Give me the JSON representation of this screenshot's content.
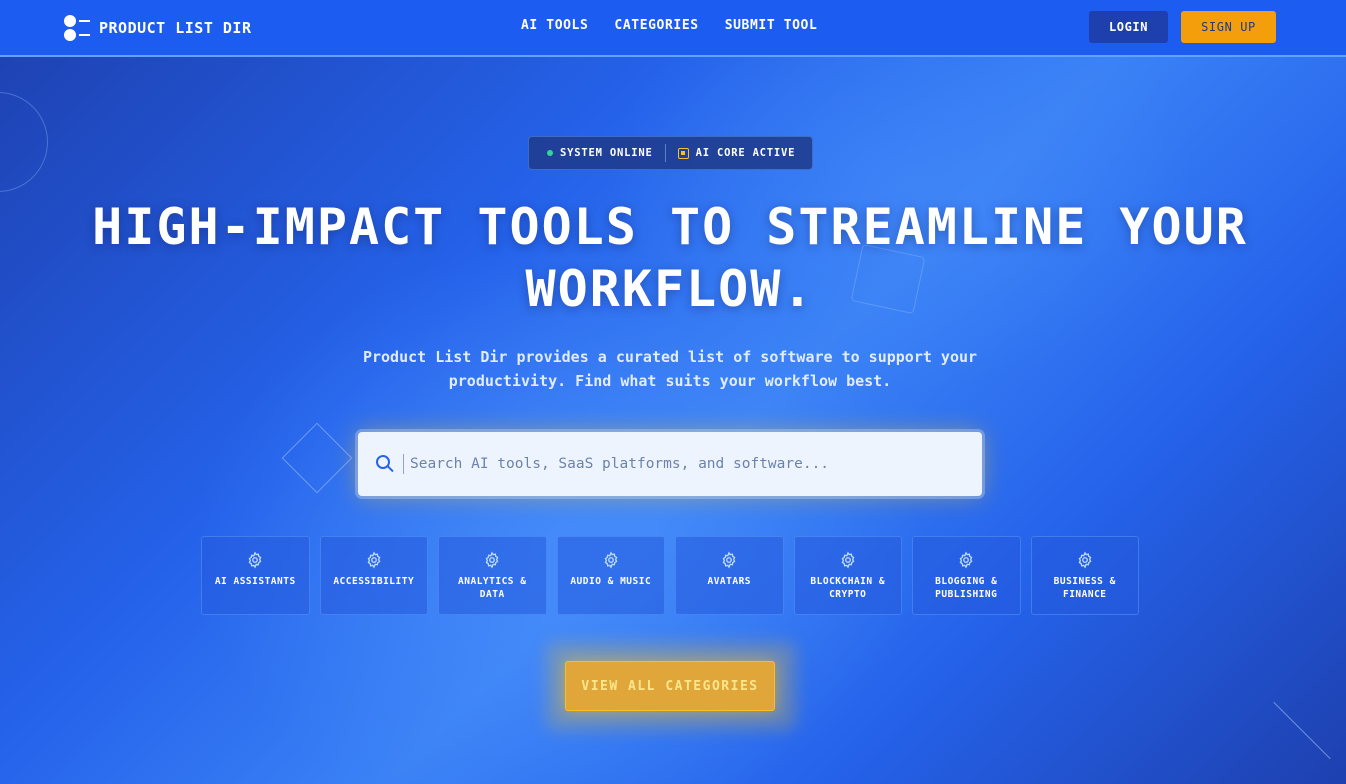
{
  "nav": {
    "brand": "PRODUCT LIST DIR",
    "links": [
      "AI TOOLS",
      "CATEGORIES",
      "SUBMIT TOOL"
    ],
    "login_label": "LOGIN",
    "signup_label": "SIGN UP"
  },
  "status": {
    "system": "SYSTEM ONLINE",
    "core": "AI CORE ACTIVE"
  },
  "hero": {
    "headline_line1": "HIGH-IMPACT TOOLS TO STREAMLINE YOUR",
    "headline_line2": "WORKFLOW.",
    "subtitle_line1": "Product List Dir provides a curated list of software to support your",
    "subtitle_line2": "productivity. Find what suits your workflow best."
  },
  "search": {
    "placeholder": "Search AI tools, SaaS platforms, and software...",
    "value": ""
  },
  "categories": [
    {
      "line1": "AI ASSISTANTS",
      "line2": "",
      "icon": "gear-icon"
    },
    {
      "line1": "ACCESSIBILITY",
      "line2": "",
      "icon": "gear-icon"
    },
    {
      "line1": "ANALYTICS &",
      "line2": "DATA",
      "icon": "gear-icon"
    },
    {
      "line1": "AUDIO & MUSIC",
      "line2": "",
      "icon": "gear-icon"
    },
    {
      "line1": "AVATARS",
      "line2": "",
      "icon": "gear-icon"
    },
    {
      "line1": "BLOCKCHAIN &",
      "line2": "CRYPTO",
      "icon": "gear-icon"
    },
    {
      "line1": "BLOGGING &",
      "line2": "PUBLISHING",
      "icon": "gear-icon"
    },
    {
      "line1": "BUSINESS &",
      "line2": "FINANCE",
      "icon": "gear-icon"
    }
  ],
  "cta": {
    "label": "VIEW ALL CATEGORIES"
  },
  "colors": {
    "primary": "#2563eb",
    "accent": "#f59e0b",
    "status_online": "#34d399"
  }
}
